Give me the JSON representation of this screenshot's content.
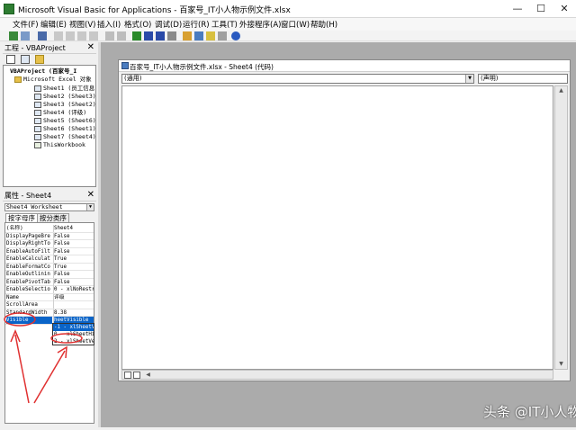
{
  "window": {
    "title": "Microsoft Visual Basic for Applications - 百家号_IT小人物示例文件.xlsx",
    "minimize": "—",
    "maximize": "☐",
    "close": "✕"
  },
  "menu": [
    "文件(F)",
    "编辑(E)",
    "视图(V)",
    "插入(I)",
    "格式(O)",
    "调试(D)",
    "运行(R)",
    "工具(T)",
    "外接程序(A)",
    "窗口(W)",
    "帮助(H)"
  ],
  "project_pane": {
    "title": "工程 - VBAProject",
    "close": "✕",
    "tree": {
      "root": "VBAProject (百家号_I",
      "folder": "Microsoft Excel 对象",
      "sheets": [
        "Sheet1 (员工信息",
        "Sheet2 (Sheet3)",
        "Sheet3 (Sheet2)",
        "Sheet4 (评级)",
        "Sheet5 (Sheet6)",
        "Sheet6 (Sheet1)",
        "Sheet7 (Sheet4)"
      ],
      "workbook": "ThisWorkbook"
    }
  },
  "properties_pane": {
    "title": "属性 - Sheet4",
    "close": "✕",
    "object_select": "Sheet4 Worksheet",
    "tabs": [
      "按字母序",
      "按分类序"
    ],
    "rows": [
      {
        "name": "(名称)",
        "value": "Sheet4"
      },
      {
        "name": "DisplayPageBre",
        "value": "False"
      },
      {
        "name": "DisplayRightTo",
        "value": "False"
      },
      {
        "name": "EnableAutoFilt",
        "value": "False"
      },
      {
        "name": "EnableCalculat",
        "value": "True"
      },
      {
        "name": "EnableFormatCo",
        "value": "True"
      },
      {
        "name": "EnableOutlinin",
        "value": "False"
      },
      {
        "name": "EnablePivotTab",
        "value": "False"
      },
      {
        "name": "EnableSelectio",
        "value": "0 - xlNoRestr"
      },
      {
        "name": "Name",
        "value": "评级"
      },
      {
        "name": "ScrollArea",
        "value": ""
      },
      {
        "name": "StandardWidth",
        "value": "8.38"
      },
      {
        "name": "Visible",
        "value": "heetVisible"
      }
    ],
    "dropdown_options": [
      "-1 - xlSheetV",
      "0 - xlSheetHi",
      "2 - xlSheetVe"
    ]
  },
  "code_window": {
    "title": "百家号_IT小人物示例文件.xlsx - Sheet4 (代码)",
    "object_combo": "(通用)",
    "proc_combo": "(声明)"
  },
  "watermark": "头条 @IT小人物",
  "colors": {
    "selection": "#0a64c8",
    "annotation": "#e03030",
    "mdi_background": "#ababab"
  }
}
